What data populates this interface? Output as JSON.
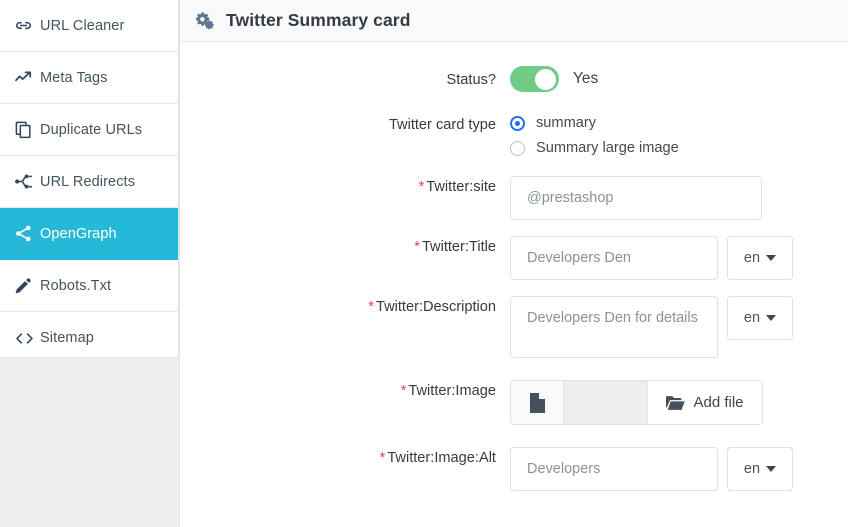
{
  "sidebar": {
    "items": [
      {
        "label": "URL Cleaner",
        "icon": "link-icon",
        "active": false
      },
      {
        "label": "Meta Tags",
        "icon": "trend-up-icon",
        "active": false
      },
      {
        "label": "Duplicate URLs",
        "icon": "copy-icon",
        "active": false
      },
      {
        "label": "URL Redirects",
        "icon": "sitemap-icon",
        "active": false
      },
      {
        "label": "OpenGraph",
        "icon": "share-icon",
        "active": true
      },
      {
        "label": "Robots.Txt",
        "icon": "pencil-icon",
        "active": false
      },
      {
        "label": "Sitemap",
        "icon": "code-icon",
        "active": false
      }
    ]
  },
  "panel": {
    "title": "Twitter Summary card",
    "title_icon": "cogs-icon"
  },
  "form": {
    "status": {
      "label": "Status?",
      "toggle_on": true,
      "value_text": "Yes"
    },
    "card_type": {
      "label": "Twitter card type",
      "options": [
        {
          "label": "summary",
          "selected": true
        },
        {
          "label": "Summary large image",
          "selected": false
        }
      ]
    },
    "site": {
      "label": "Twitter:site",
      "required": true,
      "value": "@prestashop",
      "placeholder": "@prestashop"
    },
    "title": {
      "label": "Twitter:Title",
      "required": true,
      "value": "Developers Den",
      "placeholder": "Developers Den",
      "lang": "en"
    },
    "description": {
      "label": "Twitter:Description",
      "required": true,
      "value": "Developers Den for details",
      "placeholder": "Developers Den for details",
      "lang": "en"
    },
    "image": {
      "label": "Twitter:Image",
      "required": true,
      "file_icon": "file-icon",
      "button_label": "Add file",
      "button_icon": "folder-open-icon"
    },
    "image_alt": {
      "label": "Twitter:Image:Alt",
      "required": true,
      "value": "Developers",
      "placeholder": "Developers",
      "lang": "en"
    }
  },
  "colors": {
    "accent": "#25b9d7",
    "toggle_on": "#70cb84",
    "radio_selected": "#1a6ef5",
    "required_star": "#e8434a"
  }
}
